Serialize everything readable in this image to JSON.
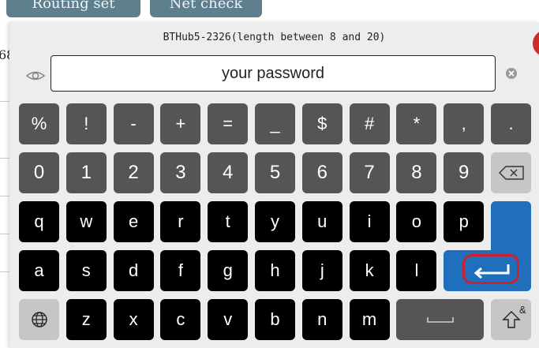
{
  "background": {
    "buttons": [
      "Routing set",
      "Net check"
    ],
    "partial_digit": "68"
  },
  "dialog": {
    "title": "BTHub5-2326(length between 8 and 20)",
    "close_symbol": "×",
    "password_placeholder": "your password"
  },
  "keyboard": {
    "row1": [
      "%",
      "!",
      "-",
      "+",
      "=",
      "_",
      "$",
      "#",
      "*",
      ",",
      "."
    ],
    "row2": [
      "0",
      "1",
      "2",
      "3",
      "4",
      "5",
      "6",
      "7",
      "8",
      "9"
    ],
    "row3": [
      "q",
      "w",
      "e",
      "r",
      "t",
      "y",
      "u",
      "i",
      "o",
      "p"
    ],
    "row4": [
      "a",
      "s",
      "d",
      "f",
      "g",
      "h",
      "j",
      "k",
      "l"
    ],
    "row5": [
      "z",
      "x",
      "c",
      "v",
      "b",
      "n",
      "m"
    ],
    "shift_label": "&"
  },
  "colors": {
    "enter_highlight": "#d0202e",
    "accent_blue": "#1f6fbd"
  }
}
